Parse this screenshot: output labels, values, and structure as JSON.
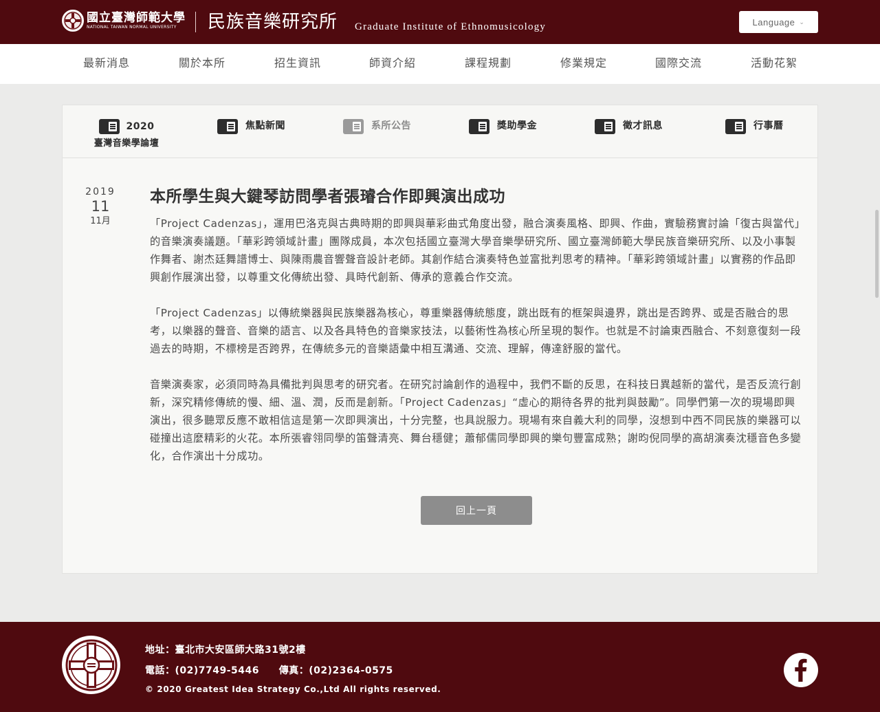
{
  "header": {
    "university_name": "國立臺灣師範大學",
    "university_name_en": "NATIONAL TAIWAN NORMAL UNIVERSITY",
    "institute_name": "民族音樂研究所",
    "institute_name_en": "Graduate Institute of Ethnomusicology",
    "language_label": "Language"
  },
  "nav": {
    "items": [
      "最新消息",
      "關於本所",
      "招生資訊",
      "師資介紹",
      "課程規劃",
      "修業規定",
      "國際交流",
      "活動花絮"
    ]
  },
  "tabs": {
    "forum_year": "2020",
    "forum_title": "臺灣音樂學論壇",
    "items": [
      "焦點新聞",
      "系所公告",
      "獎助學金",
      "徵才訊息",
      "行事曆"
    ]
  },
  "article": {
    "year": "2019",
    "day": "11",
    "month": "11月",
    "title": "本所學生與大鍵琴訪問學者張璿合作即興演出成功",
    "paragraphs": [
      "「Project Cadenzas」，運用巴洛克與古典時期的即興與華彩曲式角度出發，融合演奏風格、即興、作曲，實驗務實討論「復古與當代」的音樂演奏議題。「華彩跨領域計畫」團隊成員，本次包括國立臺灣大學音樂學研究所、國立臺灣師範大學民族音樂研究所、以及小事製作舞者、謝杰廷舞譜博士、與陳雨農音響聲音設計老師。其創作結合演奏特色並富批判思考的精神。「華彩跨領域計畫」以實務的作品即興創作展演出發，以尊重文化傳統出發、具時代創新、傳承的意義合作交流。",
      "「Project Cadenzas」以傳統樂器與民族樂器為核心，尊重樂器傳統態度，跳出既有的框架與邊界，跳出是否跨界、或是否融合的思考，以樂器的聲音、音樂的語言、以及各具特色的音樂家技法，以藝術性為核心所呈現的製作。也就是不討論東西融合、不刻意復刻一段過去的時期，不標榜是否跨界，在傳統多元的音樂語彙中相互溝通、交流、理解，傳達舒服的當代。",
      "音樂演奏家，必須同時為具備批判與思考的研究者。在研究討論創作的過程中，我們不斷的反思，在科技日異越新的當代，是否反流行創新，深究精修傳統的慢、細、溫、潤，反而是創新。「Project Cadenzas」“虛心的期待各界的批判與鼓勵”。同學們第一次的現場即興演出，很多聽眾反應不敢相信這是第一次即興演出，十分完整，也具說服力。現場有來自義大利的同學，沒想到中西不同民族的樂器可以碰撞出這麼精彩的火花。本所張睿翎同學的笛聲清亮、舞台穩健；蕭郁儒同學即興的樂句豐富成熟；謝昀倪同學的高胡演奏沈穩音色多變化，合作演出十分成功。"
    ],
    "back_label": "回上一頁"
  },
  "footer": {
    "address": "地址：臺北市大安區師大路31號2樓",
    "phone": "電話：(02)7749-5446",
    "fax": "傳真：(02)2364-0575",
    "copyright": "© 2020 Greatest Idea Strategy Co.,Ltd All rights reserved."
  },
  "colors": {
    "brand": "#4f0a0f",
    "background": "#ebebea",
    "button_gray": "#8d8d8d"
  }
}
